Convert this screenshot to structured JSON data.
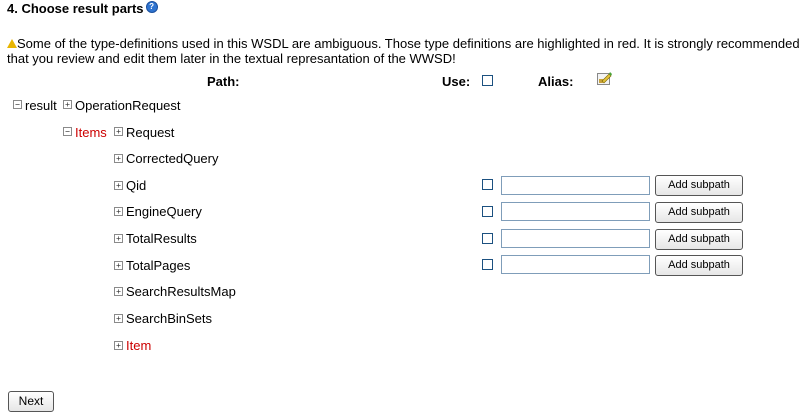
{
  "title": "4. Choose result parts",
  "warning": "Some of the type-definitions used in this WSDL are ambiguous. Those type definitions are highlighted in red. It is strongly recommended that you review and edit them later in the textual represantation of the WWSD!",
  "headers": {
    "path": "Path:",
    "use": "Use:",
    "alias": "Alias:"
  },
  "tree": {
    "root": {
      "label": "result",
      "toggle": "−"
    },
    "operation": {
      "label": "OperationRequest",
      "toggle": "+"
    },
    "items": {
      "label": "Items",
      "toggle": "−",
      "color": "#cc0000"
    },
    "request": {
      "label": "Request",
      "toggle": "+"
    },
    "children": [
      {
        "label": "CorrectedQuery",
        "toggle": "+"
      },
      {
        "label": "Qid",
        "toggle": "+"
      },
      {
        "label": "EngineQuery",
        "toggle": "+"
      },
      {
        "label": "TotalResults",
        "toggle": "+"
      },
      {
        "label": "TotalPages",
        "toggle": "+"
      },
      {
        "label": "SearchResultsMap",
        "toggle": "+"
      },
      {
        "label": "SearchBinSets",
        "toggle": "+"
      },
      {
        "label": "Item",
        "toggle": "+",
        "color": "#cc0000"
      }
    ]
  },
  "add_subpath_label": "Add subpath",
  "next_label": "Next",
  "icons": {
    "help": "help-icon",
    "warning": "warning-icon",
    "alias": "alias-edit-icon"
  }
}
